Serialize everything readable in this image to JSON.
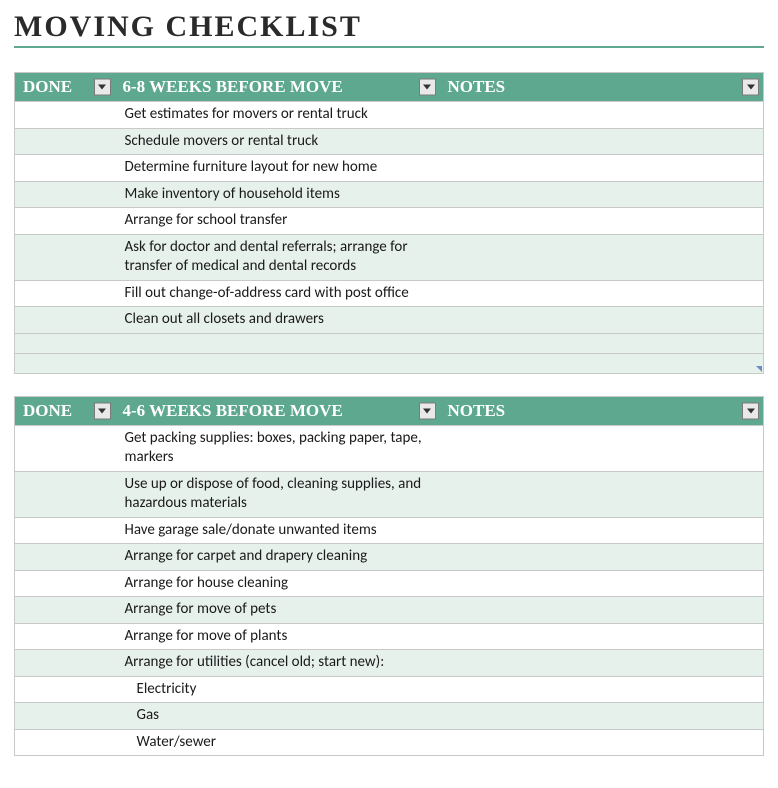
{
  "title": "MOVING CHECKLIST",
  "columns": {
    "done": "DONE",
    "notes": "NOTES"
  },
  "sections": [
    {
      "header": "6-8 WEEKS BEFORE MOVE",
      "rows": [
        {
          "task": "Get estimates for movers or rental truck"
        },
        {
          "task": "Schedule movers or rental truck"
        },
        {
          "task": "Determine furniture layout for new home"
        },
        {
          "task": "Make inventory of household items"
        },
        {
          "task": "Arrange for school transfer"
        },
        {
          "task": "Ask for doctor and dental referrals; arrange for transfer of medical and dental records"
        },
        {
          "task": "Fill out change-of-address card with post office"
        },
        {
          "task": "Clean out all closets and drawers"
        }
      ],
      "trailing_blank_rows": 2
    },
    {
      "header": "4-6 WEEKS BEFORE MOVE",
      "rows": [
        {
          "task": "Get packing supplies: boxes, packing paper, tape, markers"
        },
        {
          "task": "Use up or dispose of food, cleaning supplies, and hazardous materials"
        },
        {
          "task": "Have garage sale/donate unwanted items"
        },
        {
          "task": "Arrange for carpet and drapery cleaning"
        },
        {
          "task": "Arrange for house cleaning"
        },
        {
          "task": "Arrange for move of pets"
        },
        {
          "task": "Arrange for move of plants"
        },
        {
          "task": "Arrange for utilities (cancel old; start new):"
        },
        {
          "task": "Electricity",
          "indent": true
        },
        {
          "task": "Gas",
          "indent": true
        },
        {
          "task": "Water/sewer",
          "indent": true
        }
      ],
      "trailing_blank_rows": 0
    }
  ]
}
